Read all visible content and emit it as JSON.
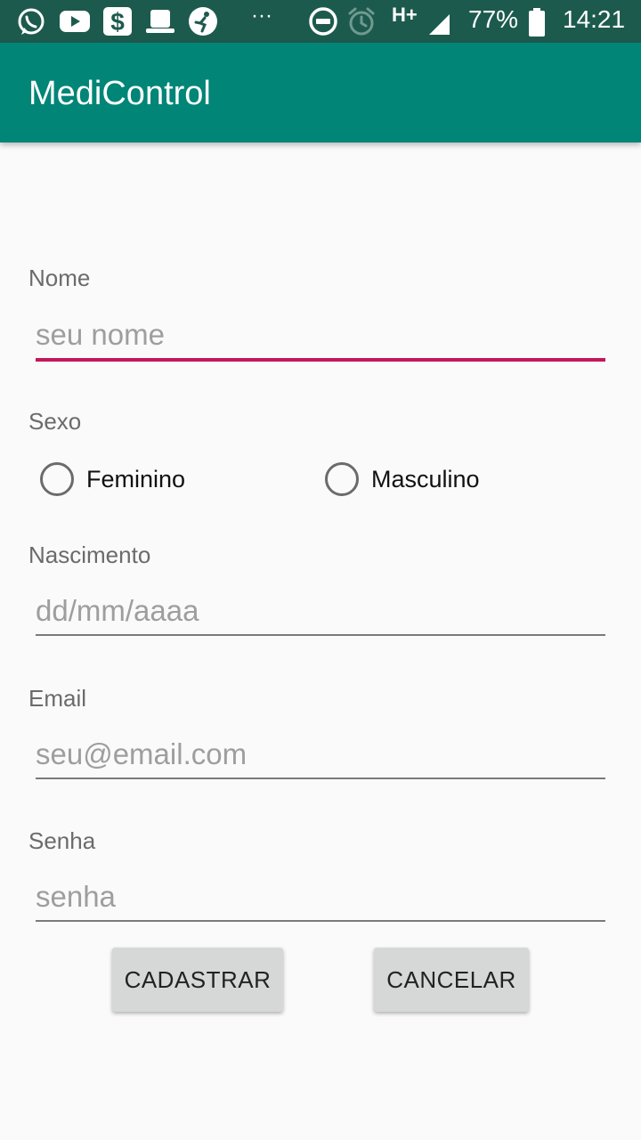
{
  "status_bar": {
    "icons": [
      "whatsapp-icon",
      "youtube-icon",
      "dollar-app-icon",
      "hat-icon",
      "soccer-icon",
      "more-notifications-icon",
      "do-not-disturb-icon",
      "alarm-icon",
      "signal-icon",
      "battery-icon"
    ],
    "more": "···",
    "network": "H+",
    "battery": "77%",
    "time": "14:21"
  },
  "app_bar": {
    "title": "MediControl",
    "color": "#008577"
  },
  "form": {
    "name": {
      "label": "Nome",
      "placeholder": "seu nome",
      "value": ""
    },
    "sex": {
      "label": "Sexo",
      "options": [
        "Feminino",
        "Masculino"
      ],
      "selected": null
    },
    "birth": {
      "label": "Nascimento",
      "placeholder": "dd/mm/aaaa",
      "value": ""
    },
    "email": {
      "label": "Email",
      "placeholder": "seu@email.com",
      "value": ""
    },
    "password": {
      "label": "Senha",
      "placeholder": "senha",
      "value": ""
    }
  },
  "buttons": {
    "register": "CADASTRAR",
    "cancel": "CANCELAR"
  },
  "colors": {
    "status_bar": "#1d5a4e",
    "accent": "#c2185b"
  }
}
